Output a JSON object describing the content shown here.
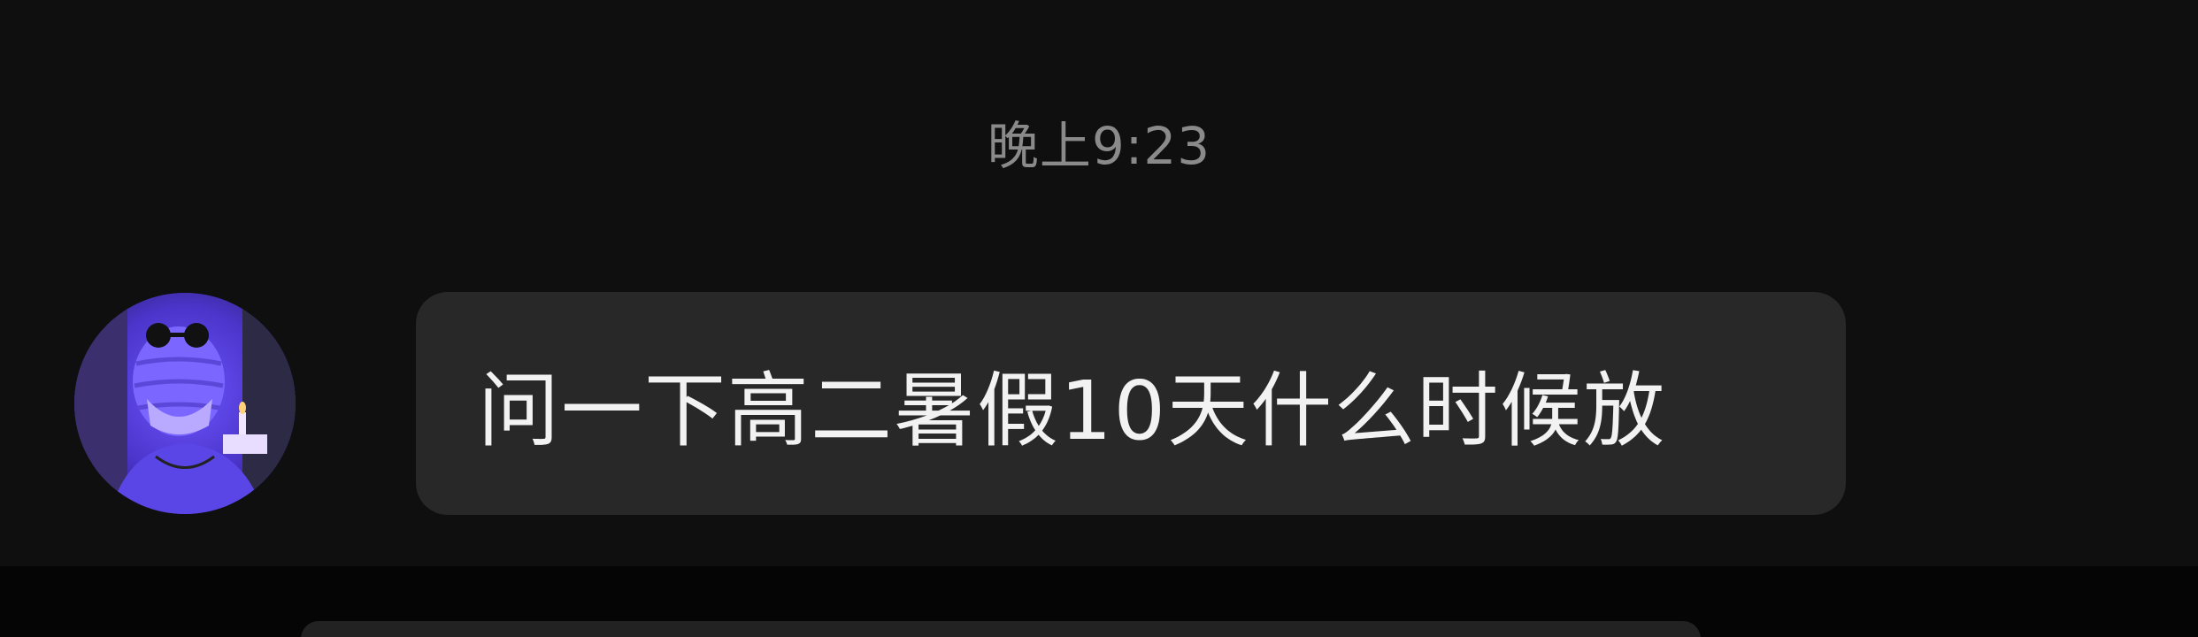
{
  "chat": {
    "timestamp": "晚上9:23",
    "messages": [
      {
        "text": "问一下高二暑假10天什么时候放",
        "avatar": "user-avatar-purple"
      }
    ]
  },
  "colors": {
    "background": "#0e0e0e",
    "bubble": "#282828",
    "timestamp_text": "#8a8a8a",
    "message_text": "#f2f2f2",
    "avatar_tint": "#5b3cf0"
  }
}
